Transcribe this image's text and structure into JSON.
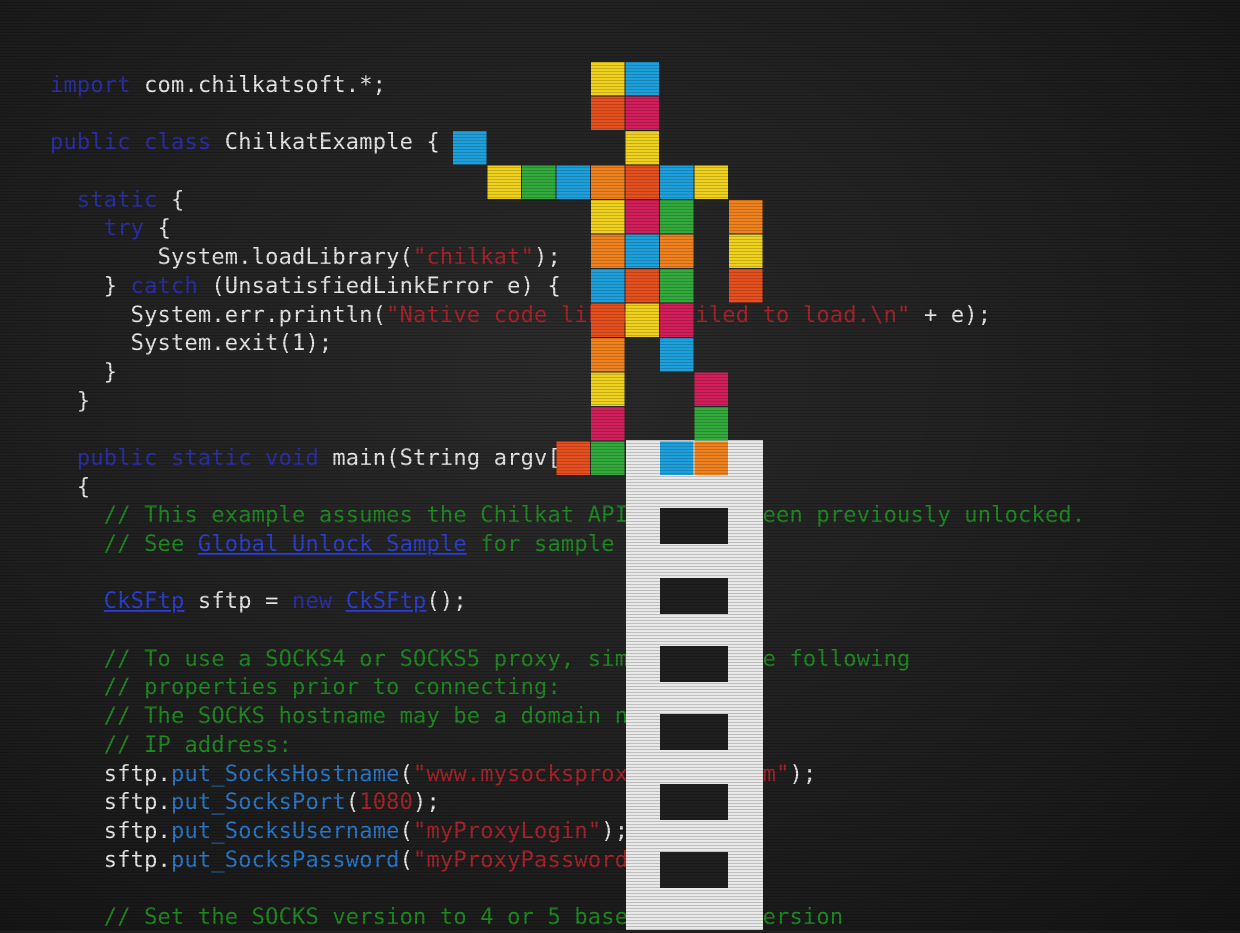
{
  "code": {
    "import_kw": "import",
    "import_rest": " com.chilkatsoft.*;",
    "class_kw1": "public",
    "class_kw2": "class",
    "class_rest": " ChilkatExample {",
    "static_kw": "static",
    "static_rest": " {",
    "try_kw": "try",
    "try_rest": " {",
    "loadlib_pre": "System.loadLibrary(",
    "loadlib_str": "\"chilkat\"",
    "loadlib_post": ");",
    "catch_pre": "} ",
    "catch_kw": "catch",
    "catch_rest": " (UnsatisfiedLinkError e) {",
    "println_pre": "System.err.println(",
    "println_str": "\"Native code library failed to load.\\n\"",
    "println_post": " + e);",
    "exit_line": "System.exit(1);",
    "close1": "}",
    "close2": "}",
    "main_kw1": "public",
    "main_kw2": "static",
    "main_kw3": "void",
    "main_rest": " main(String argv[])",
    "brace_open": "{",
    "comment1": "// This example assumes the Chilkat API to have been previously unlocked.",
    "comment2_pre": "// See ",
    "comment2_link": "Global Unlock Sample",
    "comment2_post": " for sample code.",
    "new_type": "CkSFtp",
    "new_mid": " sftp = ",
    "new_kw": "new",
    "new_ctor": "CkSFtp",
    "new_post": "();",
    "comment3": "// To use a SOCKS4 or SOCKS5 proxy, simply set the following",
    "comment4": "// properties prior to connecting:",
    "comment5": "// The SOCKS hostname may be a domain name or",
    "comment6": "// IP address:",
    "host_obj": "sftp.",
    "host_m": "put_SocksHostname",
    "host_str": "\"www.mysocksproxyserver.com\"",
    "host_post": ");",
    "port_obj": "sftp.",
    "port_m": "put_SocksPort",
    "port_num": "1080",
    "port_post": ");",
    "user_obj": "sftp.",
    "user_m": "put_SocksUsername",
    "user_str": "\"myProxyLogin\"",
    "user_post": ");",
    "pass_obj": "sftp.",
    "pass_m": "put_SocksPassword",
    "pass_str": "\"myProxyPassword\"",
    "pass_post": ");",
    "comment7": "// Set the SOCKS version to 4 or 5 based on the version"
  },
  "colors": {
    "keyword": "#2c2fa8",
    "string": "#a8242a",
    "comment": "#1f8a22",
    "method": "#2a78c8",
    "text": "#e6e6e6",
    "tile_yellow": "#f0d21e",
    "tile_blue": "#1ea0dc",
    "tile_orange": "#f0821e",
    "tile_red": "#e6501e",
    "tile_magenta": "#d21e5a",
    "tile_green": "#32aa3c",
    "ladder": "#e8e8e8"
  }
}
